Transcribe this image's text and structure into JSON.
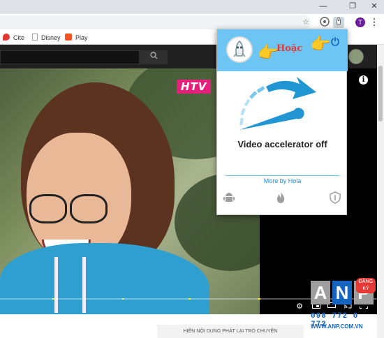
{
  "browser": {
    "window_controls": {
      "minimize": "—",
      "restore": "❐",
      "close": "✕"
    },
    "toolbar": {
      "star_icon": "☆",
      "menu_icon": "⋮",
      "profile_initial": "T"
    },
    "bookmarks": [
      {
        "label": "Cite",
        "icon": "cite-icon",
        "color": "#e53935"
      },
      {
        "label": "Disney",
        "icon": "page-icon",
        "color": "#9e9e9e"
      },
      {
        "label": "Play",
        "icon": "play-icon",
        "color": "#f4511e"
      }
    ]
  },
  "youtube": {
    "search_icon": "search-icon",
    "video": {
      "channel_logo": "HTV",
      "progress": 0,
      "controls": [
        "settings-icon",
        "miniplayer-icon",
        "theater-icon",
        "cast-icon",
        "fullscreen-icon"
      ]
    },
    "below_button": "HIỆN NỘI DUNG PHÁT LẠI TRÒ CHUYỆN"
  },
  "popup": {
    "annotation": "Hoặc",
    "status_text": "Video accelerator off",
    "more_link": "More by Hola",
    "accent_color": "#6cc5f2",
    "bottom_icons": [
      "android-icon",
      "flame-icon",
      "shield-icon"
    ]
  },
  "watermark": {
    "letters": [
      "A",
      "N",
      "P"
    ],
    "badge": "ĐĂNG KÝ",
    "phone": "098 772 0 772",
    "website": "WWW.ANP.COM.VN"
  }
}
